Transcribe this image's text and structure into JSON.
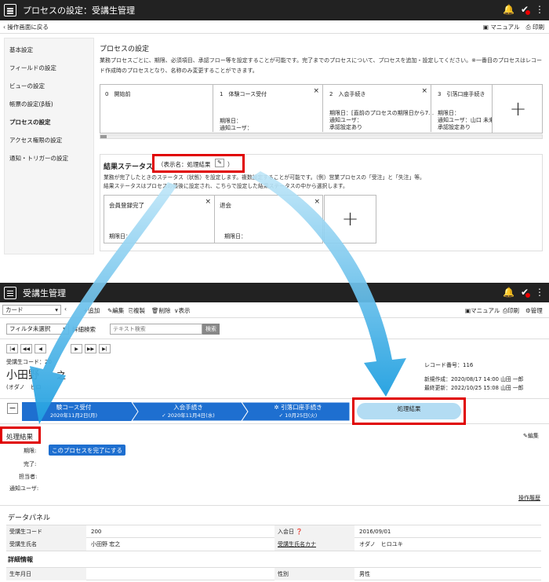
{
  "top": {
    "window_title": "プロセスの設定：受講生管理",
    "back_label": "操作画面に戻る",
    "manual_label": "マニュアル",
    "print_label": "印刷",
    "nav": [
      "基本設定",
      "フィールドの設定",
      "ビューの設定",
      "帳票の設定(β版)",
      "プロセスの設定",
      "アクセス権限の設定",
      "通知・トリガーの設定"
    ],
    "section_title": "プロセスの設定",
    "section_desc": "業務プロセスごとに、期限、必須項目、承認フロー等を設定することが可能です。完了までのプロセスについて、プロセスを追加・設定してください。※一番目のプロセスはレコード作成時のプロセスとなり、名称のみ変更することができます。",
    "steps": [
      {
        "name": "0　開始前",
        "lines": []
      },
      {
        "name": "1　体験コース受付",
        "lines": [
          "期限日：",
          "通知ユーザ："
        ]
      },
      {
        "name": "2　入会手続き",
        "lines": [
          "期限日：[直前のプロセスの期限日から7…",
          "通知ユーザ：",
          "承認設定あり"
        ]
      },
      {
        "name": "3　引落口座手続き",
        "lines": [
          "期限日：",
          "通知ユーザ：山口 未来",
          "承認設定あり"
        ]
      }
    ],
    "result_title": "結果ステータス",
    "display_name_label": "（表示名：処理結果",
    "result_desc1": "業務が完了したときのステータス（状態）を設定します。複数設定することが可能です。（例）営業プロセスの「受注」と「失注」等。",
    "result_desc2": "結果ステータスはプロセスの最後に設定され、こちらで設定した結果ステータスの中から選択します。",
    "result_items": [
      {
        "name": "会員登録完了",
        "deadline": "期限日："
      },
      {
        "name": "退会",
        "deadline": "期限日："
      }
    ]
  },
  "bottom": {
    "window_title": "受講生管理",
    "view_select": "カード",
    "toolbar": [
      "追加",
      "編集",
      "複製",
      "削除",
      "表示"
    ],
    "manual_label": "マニュアル",
    "print_label": "印刷",
    "admin_label": "管理",
    "filter_select": "フィルタ未選択",
    "detail_search": "詳細検索",
    "search_placeholder": "テキスト検索",
    "search_button": "検索",
    "student_code_label": "受講生コード：20",
    "student_name": "小田野",
    "student_name_cut": "之",
    "student_kana": "(オダノ　ヒロ",
    "record_no": "レコード番号：116",
    "created": "新規作成：2020/08/17 14:00 山田 一郎",
    "updated": "最終更新：2022/10/25 15:08 山田 一郎",
    "process_steps": [
      {
        "name": "験コース受付",
        "date": "2020年11月2日(月)"
      },
      {
        "name": "入会手続き",
        "date": "✓ 2020年11月4日(水)"
      },
      {
        "name": "引落口座手続き",
        "date": "✓ 10月25日(火)"
      }
    ],
    "result_step": "処理結果",
    "result_heading": "処理結果",
    "edit_label": "編集",
    "fields": [
      "期限:",
      "完了:",
      "担当者:",
      "通知ユーザ:"
    ],
    "complete_button": "このプロセスを完了にする",
    "history_link": "操作履歴",
    "data_panel": "データパネル",
    "rows": [
      {
        "l1": "受講生コード",
        "v1": "200",
        "l2": "入会日",
        "v2": "2016/09/01"
      },
      {
        "l1": "受講生氏名",
        "v1": "小田野 宏之",
        "l2": "受講生氏名カナ",
        "v2": "オダノ　ヒロユキ"
      }
    ],
    "detail_heading": "詳細情報",
    "row3": {
      "l1": "生年月日",
      "v1": "",
      "l2": "性別",
      "v2": "男性"
    }
  },
  "colors": {
    "accent_blue": "#1e6fd0",
    "highlight_red": "#e00000",
    "arrow_blue": "#29a8e6"
  }
}
